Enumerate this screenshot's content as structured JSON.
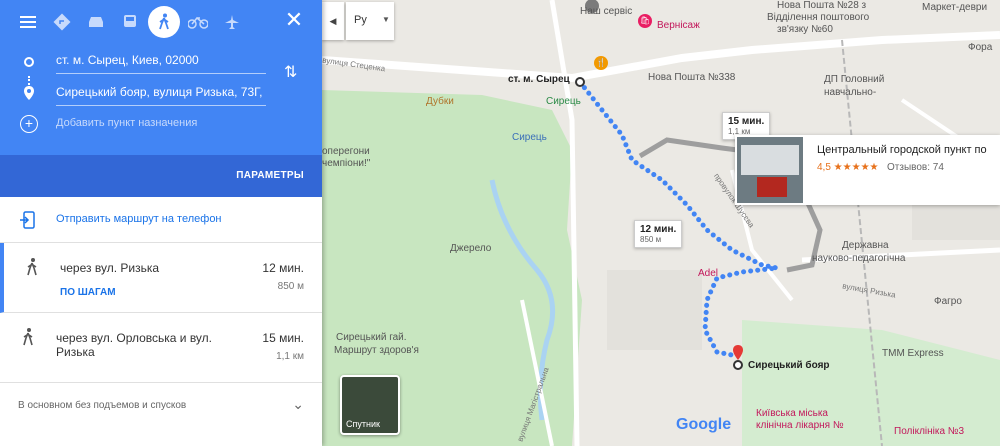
{
  "panel": {
    "modes": [
      "menu-icon",
      "car-route-icon",
      "car-icon",
      "transit-icon",
      "walking-icon",
      "bicycle-icon",
      "flight-icon"
    ],
    "origin": "ст. м. Сырец, Киев, 02000",
    "destination": "Сирецький бояр, вулиця Ризька, 73Г,",
    "add_destination": "Добавить пункт назначения",
    "params": "ПАРАМЕТРЫ",
    "send_to_phone": "Отправить маршрут на телефон",
    "routes": [
      {
        "name": "через вул. Ризька",
        "time": "12 мин.",
        "dist": "850 м",
        "steps": "ПО ШАГАМ"
      },
      {
        "name": "через вул. Орловська и вул. Ризька",
        "time": "15 мин.",
        "dist": "1,1 км"
      }
    ],
    "hills": "В основном без подъемов и спусков"
  },
  "map": {
    "lang": "Ру",
    "labels": {
      "nash_servis": "Наш сервіс",
      "vernisazh": "Вернісаж",
      "viddilennya": "Відділення поштового",
      "zvyazku": "зв'язку №60",
      "nova_poshta_28": "Нова Пошта №28 з",
      "market": "Маркет-деври",
      "fora": "Фора",
      "stetsenka": "вулиця Стеценка",
      "nova_poshta": "Нова Пошта №338",
      "dp_golovnyi": "ДП Головний",
      "navchalno": "навчально-",
      "syrets_metro": "ст. м. Сырец",
      "syrets": "Сирець",
      "syrets_bus": "Сирець",
      "dubky": "Дубки",
      "peregony": "оперегони",
      "champions": "чемпіони!\"",
      "dzherelo": "Джерело",
      "syrets_gai": "Сирецький гай.",
      "marshrut": "Маршрут здоров'я",
      "derzhavna": "Державна",
      "naukovo": "науково-педагогічна",
      "adel": "Adel",
      "fagro": "Фагро",
      "tmm": "TMM Express",
      "klinichna": "Київська міська",
      "likarnya": "клінічна лікарня №",
      "poliklinika": "Поліклініка №3",
      "ryzka_road": "вулиця Ризька",
      "shusheva": "провулок Шусєва",
      "magistralna": "вулиця Магістральна",
      "destination_pin": "Сирецький бояр"
    },
    "bubble_12": {
      "time": "12 мин.",
      "dist": "850 м"
    },
    "bubble_15": {
      "time": "15 мин.",
      "dist": "1,1 км"
    },
    "place": {
      "title": "Центральный городской пункт по",
      "rating": "4,5 ★★★★★",
      "reviews": "Отзывов: 74"
    },
    "satellite": "Спутник",
    "google": "Google"
  }
}
